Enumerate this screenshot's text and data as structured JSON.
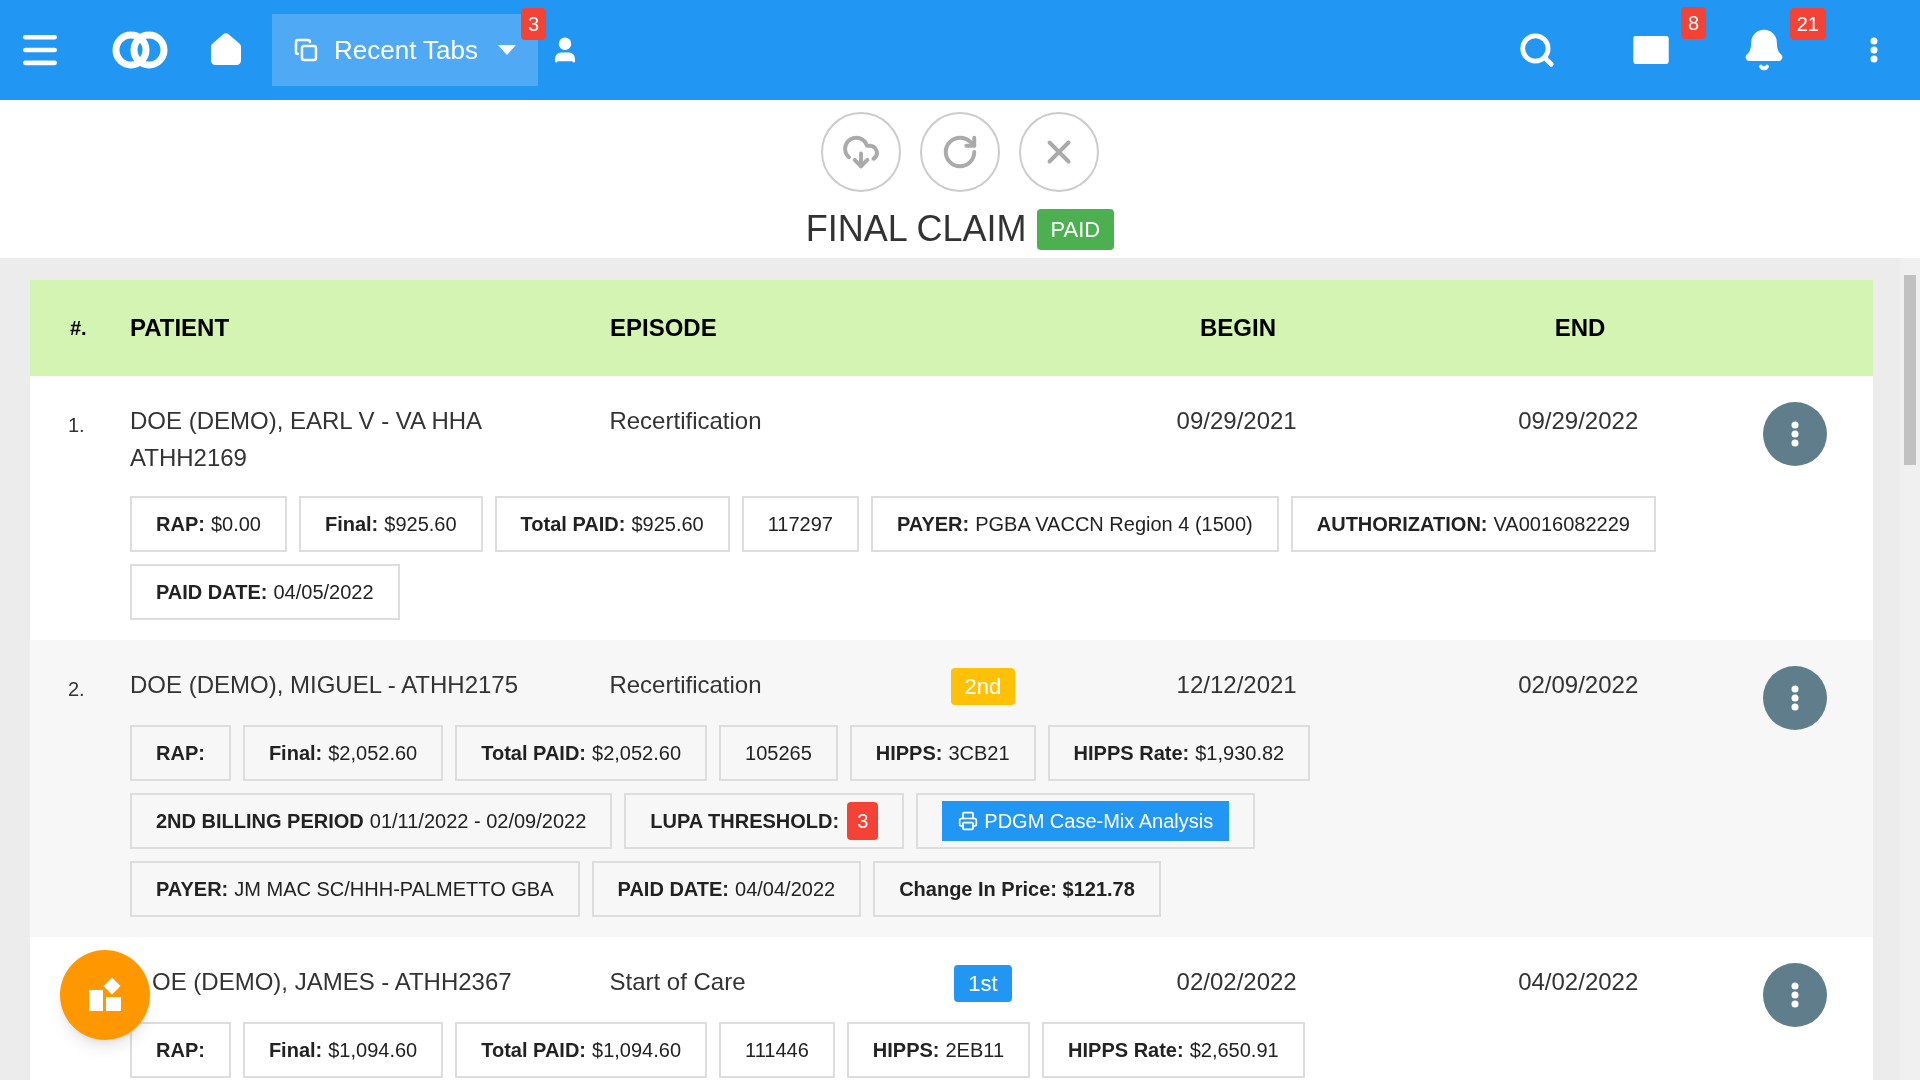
{
  "topbar": {
    "recent_tabs": {
      "label": "Recent Tabs",
      "count": "3"
    },
    "mail_count": "8",
    "notification_count": "21"
  },
  "header": {
    "title": "FINAL CLAIM",
    "status": "PAID"
  },
  "table": {
    "columns": [
      "#.",
      "PATIENT",
      "EPISODE",
      "BEGIN",
      "END"
    ],
    "rows": [
      {
        "number": "1.",
        "patient": "DOE (DEMO), EARL V - VA HHA ATHH2169",
        "episode": "Recertification",
        "begin": "09/29/2021",
        "end": "09/29/2022",
        "tags": [
          {
            "kind": "plain",
            "label": "RAP:",
            "value": "$0.00"
          },
          {
            "kind": "plain",
            "label": "Final:",
            "value": "$925.60"
          },
          {
            "kind": "plain",
            "label": "Total PAID:",
            "value": "$925.60"
          },
          {
            "kind": "plain",
            "value": "117297"
          },
          {
            "kind": "plain",
            "label": "PAYER:",
            "value": "PGBA VACCN Region 4 (1500)"
          },
          {
            "kind": "plain",
            "label": "AUTHORIZATION:",
            "value": "VA0016082229"
          },
          {
            "kind": "plain",
            "label": "PAID DATE:",
            "value": "04/05/2022"
          }
        ]
      },
      {
        "number": "2.",
        "patient": "DOE (DEMO), MIGUEL - ATHH2175",
        "episode": "Recertification",
        "period": {
          "label": "2nd",
          "color": "#ffc107"
        },
        "begin": "12/12/2021",
        "end": "02/09/2022",
        "tags": [
          {
            "kind": "plain",
            "label": "RAP:"
          },
          {
            "kind": "plain",
            "label": "Final:",
            "value": "$2,052.60"
          },
          {
            "kind": "plain",
            "label": "Total PAID:",
            "value": "$2,052.60"
          },
          {
            "kind": "plain",
            "value": "105265"
          },
          {
            "kind": "plain",
            "label": "HIPPS:",
            "value": "3CB21"
          },
          {
            "kind": "plain",
            "label": "HIPPS Rate:",
            "value": "$1,930.82"
          },
          {
            "kind": "plain",
            "label": "2ND BILLING PERIOD",
            "value": "01/11/2022 - 02/09/2022"
          },
          {
            "kind": "count",
            "label": "LUPA THRESHOLD:",
            "count": "3"
          },
          {
            "kind": "action",
            "label": "PDGM Case-Mix Analysis"
          },
          {
            "kind": "plain",
            "label": "PAYER:",
            "value": "JM MAC SC/HHH-PALMETTO GBA"
          },
          {
            "kind": "plain",
            "label": "PAID DATE:",
            "value": "04/04/2022"
          },
          {
            "kind": "plain",
            "label": "Change In Price: $121.78"
          }
        ]
      },
      {
        "patient": "OE (DEMO), JAMES - ATHH2367",
        "episode": "Start of Care",
        "period": {
          "label": "1st",
          "color": "#2196f3"
        },
        "begin": "02/02/2022",
        "end": "04/02/2022",
        "tags": [
          {
            "kind": "plain",
            "label": "RAP:"
          },
          {
            "kind": "plain",
            "label": "Final:",
            "value": "$1,094.60"
          },
          {
            "kind": "plain",
            "label": "Total PAID:",
            "value": "$1,094.60"
          },
          {
            "kind": "plain",
            "value": "111446"
          },
          {
            "kind": "plain",
            "label": "HIPPS:",
            "value": "2EB11"
          },
          {
            "kind": "plain",
            "label": "HIPPS Rate:",
            "value": "$2,650.91"
          }
        ]
      }
    ]
  }
}
